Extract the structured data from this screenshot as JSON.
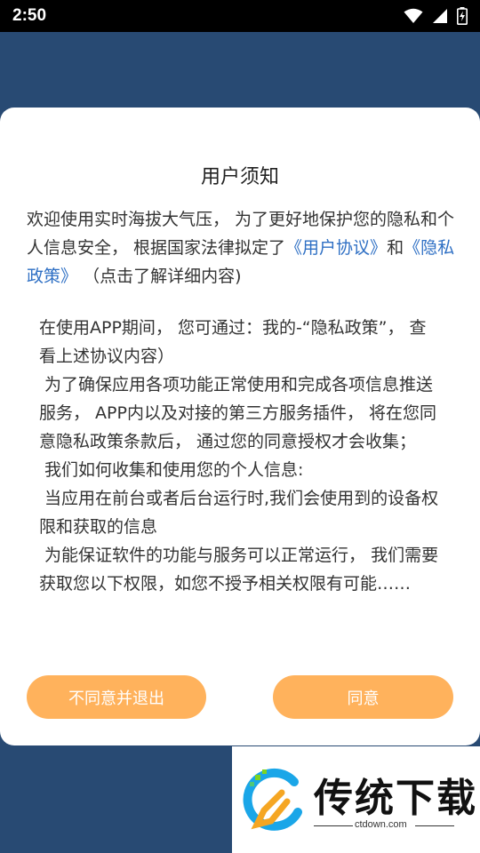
{
  "status_bar": {
    "time": "2:50"
  },
  "dialog": {
    "title": "用户须知",
    "intro": {
      "text_before": "欢迎使用实时海拔大气压， 为了更好地保护您的隐私和个人信息安全， 根据国家法律拟定了",
      "user_agreement_link": "《用户协议》",
      "connector": "和",
      "privacy_policy_link": "《隐私政策》",
      "text_after": "（点击了解详细内容)"
    },
    "terms_lines": [
      "在使用APP期间， 您可通过：我的-“隐私政策”， 查看上述协议内容）",
      " 为了确保应用各项功能正常使用和完成各项信息推送服务， APP内以及对接的第三方服务插件， 将在您同意隐私政策条款后， 通过您的同意授权才会收集；",
      " 我们如何收集和使用您的个人信息:",
      " 当应用在前台或者后台运行时,我们会使用到的设备权限和获取的信息",
      " 为能保证软件的功能与服务可以正常运行， 我们需要获取您以下权限，如您不授予相关权限有可能……"
    ],
    "disagree_button": "不同意并退出",
    "agree_button": "同意"
  },
  "watermark": {
    "brand": "传统下载",
    "url": "ctdown.com"
  }
}
